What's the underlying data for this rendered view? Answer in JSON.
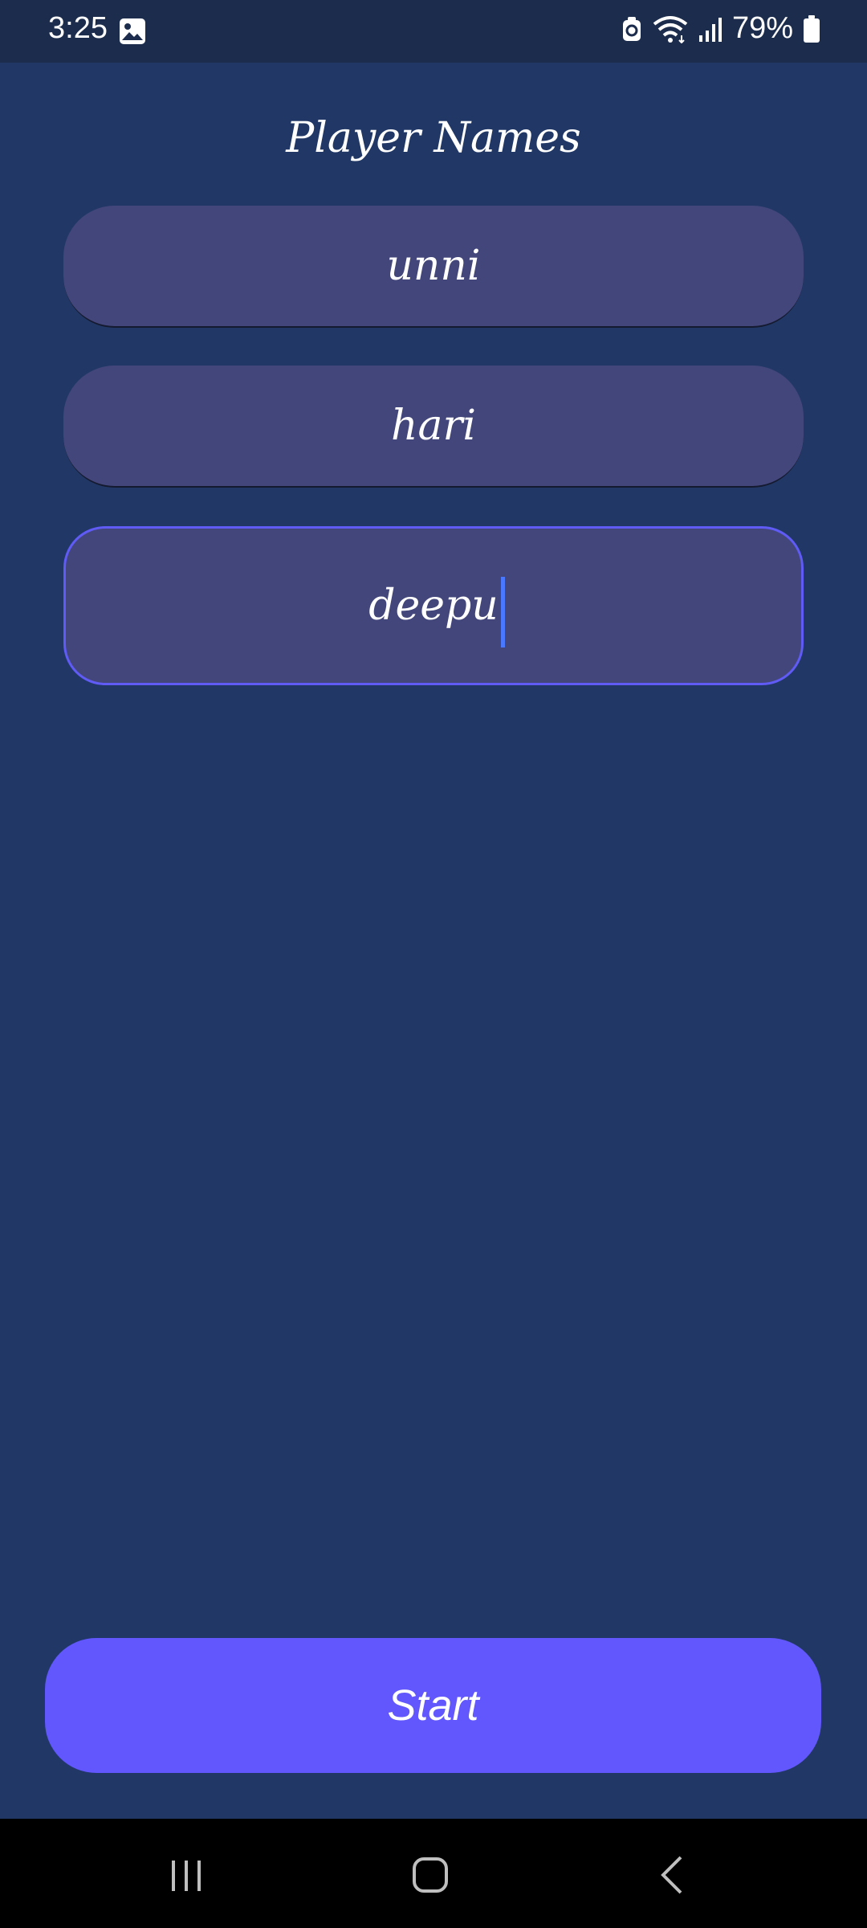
{
  "status_bar": {
    "time": "3:25",
    "battery": "79%",
    "icons": [
      "gallery-icon",
      "data-saver-icon",
      "wifi-icon",
      "signal-icon",
      "battery-icon"
    ]
  },
  "title": "Player Names",
  "players": [
    {
      "name": "unni"
    },
    {
      "name": "hari"
    },
    {
      "name": "deepu"
    }
  ],
  "start_label": "Start",
  "nav": {
    "icons": [
      "recent-apps-icon",
      "home-icon",
      "back-icon"
    ]
  },
  "colors": {
    "background": "#213866",
    "field": "#43467a",
    "focus_border": "#5f5bf4",
    "button": "#6157fd",
    "caret": "#4a78ff"
  }
}
